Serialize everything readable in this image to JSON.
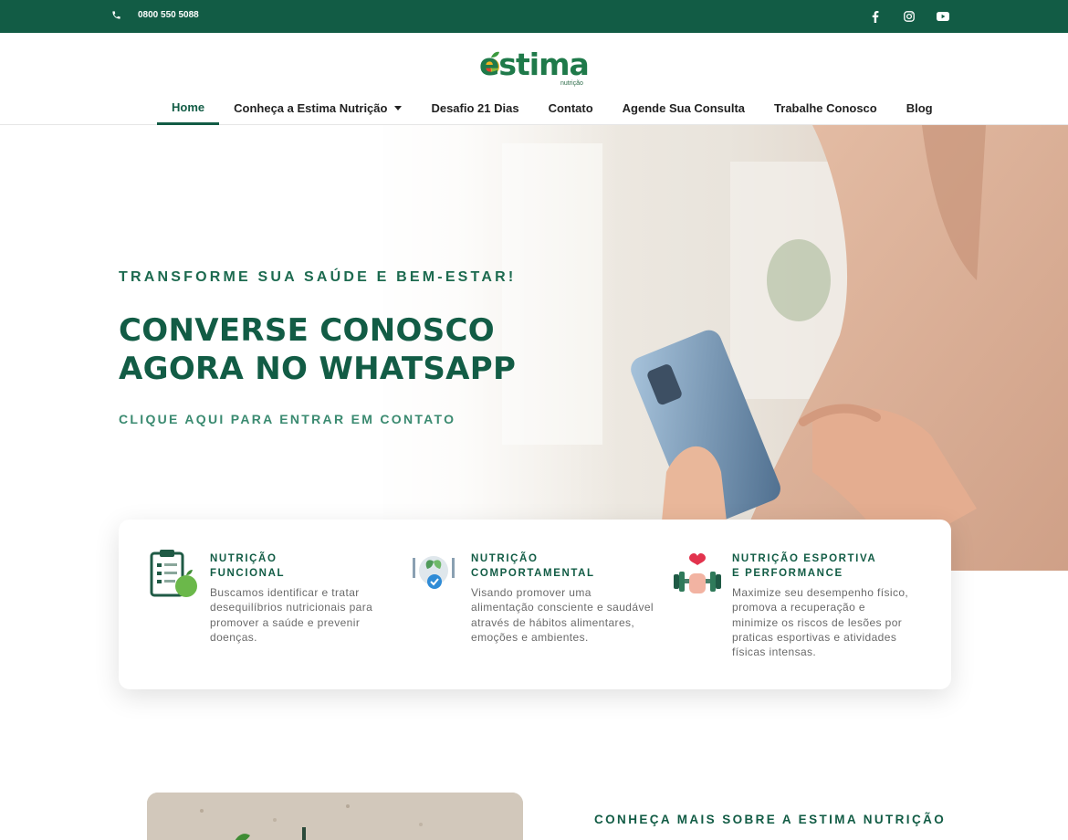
{
  "topbar": {
    "phone": "0800 550 5088",
    "social": [
      "facebook-icon",
      "instagram-icon",
      "youtube-icon"
    ]
  },
  "logo": {
    "word": "estima",
    "sub": "nutrição"
  },
  "nav": {
    "items": [
      {
        "label": "Home",
        "active": true
      },
      {
        "label": "Conheça a Estima Nutrição",
        "dropdown": true
      },
      {
        "label": "Desafio 21 Dias"
      },
      {
        "label": "Contato"
      },
      {
        "label": "Agende Sua Consulta"
      },
      {
        "label": "Trabalhe Conosco"
      },
      {
        "label": "Blog"
      }
    ]
  },
  "hero": {
    "kicker": "TRANSFORME SUA SAÚDE E BEM-ESTAR!",
    "title_line1": "CONVERSE CONOSCO",
    "title_line2": "AGORA NO WHATSAPP",
    "cta": "CLIQUE AQUI PARA ENTRAR EM CONTATO"
  },
  "features": [
    {
      "title_line1": "NUTRIÇÃO",
      "title_line2": "FUNCIONAL",
      "text": "Buscamos identificar e tratar desequilíbrios nutricionais para promover a saúde e prevenir doenças.",
      "icon": "clipboard-apple-icon"
    },
    {
      "title_line1": "NUTRIÇÃO",
      "title_line2": "COMPORTAMENTAL",
      "text": "Visando promover uma alimentação consciente e saudável através de hábitos alimentares, emoções e ambientes.",
      "icon": "plate-leaf-icon"
    },
    {
      "title_line1": "NUTRIÇÃO ESPORTIVA",
      "title_line2": "E PERFORMANCE",
      "text": "Maximize seu desempenho físico, promova a recuperação e minimize os riscos de lesões por praticas esportivas e atividades físicas intensas.",
      "icon": "dumbbell-heart-icon"
    }
  ],
  "about": {
    "title": "CONHEÇA MAIS SOBRE A ESTIMA NUTRIÇÃO"
  },
  "colors": {
    "brand": "#125c45",
    "accent": "#3a8a70"
  }
}
